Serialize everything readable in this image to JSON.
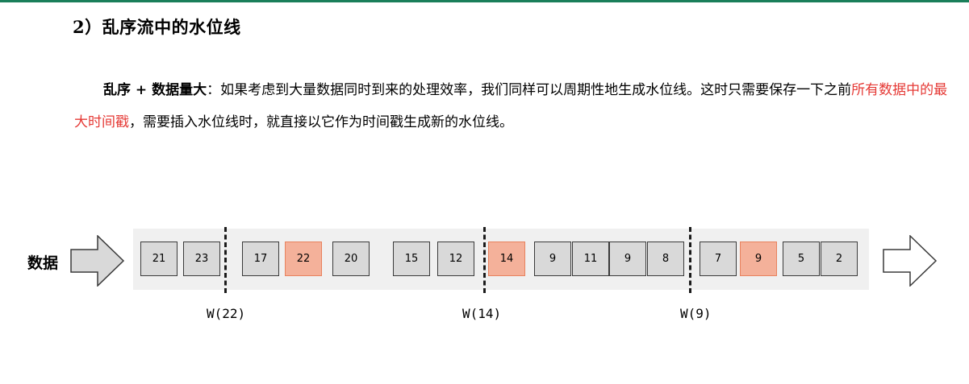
{
  "heading": "2）乱序流中的水位线",
  "paragraph": {
    "bold_lead": "乱序 + 数据量大",
    "after_bold": "：如果考虑到大量数据同时到来的处理效率，我们同样可以周期性地生成水位线。这时只需要保存一下之前",
    "highlight": "所有数据中的最大时间戳",
    "after_highlight": "，需要插入水位线时，就直接以它作为时间戳生成新的水位线。"
  },
  "diagram": {
    "data_label": "数据",
    "cells": [
      {
        "value": "21",
        "highlight": false
      },
      {
        "value": "23",
        "highlight": false
      },
      {
        "value": "17",
        "highlight": false
      },
      {
        "value": "22",
        "highlight": true
      },
      {
        "value": "20",
        "highlight": false
      },
      {
        "value": "15",
        "highlight": false
      },
      {
        "value": "12",
        "highlight": false
      },
      {
        "value": "14",
        "highlight": true
      },
      {
        "value": "9",
        "highlight": false
      },
      {
        "value": "11",
        "highlight": false
      },
      {
        "value": "9",
        "highlight": false
      },
      {
        "value": "8",
        "highlight": false
      },
      {
        "value": "7",
        "highlight": false
      },
      {
        "value": "9",
        "highlight": true
      },
      {
        "value": "5",
        "highlight": false
      },
      {
        "value": "2",
        "highlight": false
      }
    ],
    "watermarks": [
      "W(22)",
      "W(14)",
      "W(9)"
    ]
  },
  "colors": {
    "accent_rule": "#1a7f5a",
    "highlight_text": "#e53935",
    "cell_fill": "#d9d9d9",
    "cell_highlight_fill": "#f4b19a"
  }
}
